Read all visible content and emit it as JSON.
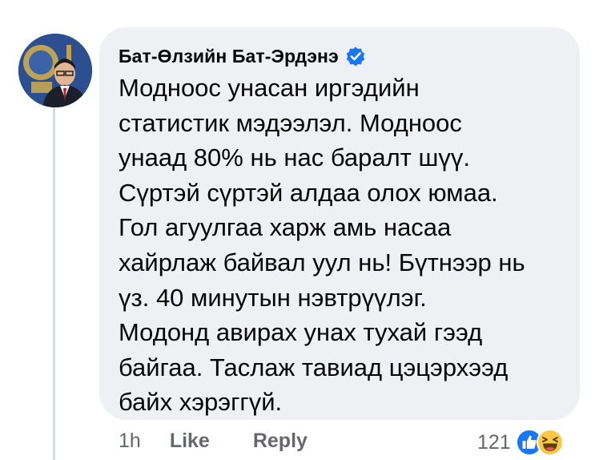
{
  "comment": {
    "author": "Бат-Өлзийн Бат-Эрдэнэ",
    "verified_icon": "verified-badge-icon",
    "text_lines": [
      "Модноос унасан иргэдийн",
      "статистик мэдээлэл. Модноос",
      "унаад 80% нь нас баралт шүү.",
      "Сүртэй сүртэй алдаа олох юмаа.",
      "Гол агуулгаа харж амь насаа",
      "хайрлаж байвал уул нь! Бүтнээр нь",
      "үз. 40 минутын нэвтрүүлэг.",
      "Модонд авирах унах тухай гээд",
      "байгаа. Таслаж тавиад цэцэрхээд",
      "байх хэрэггүй."
    ]
  },
  "actions": {
    "time": "1h",
    "like_label": "Like",
    "reply_label": "Reply"
  },
  "reactions": {
    "count": "121",
    "icons": [
      "like-reaction-icon",
      "haha-reaction-icon"
    ]
  },
  "colors": {
    "bubble_bg": "#eef0f3",
    "text": "#050505",
    "secondary_text": "#65676b",
    "verified_blue": "#1877f2"
  }
}
